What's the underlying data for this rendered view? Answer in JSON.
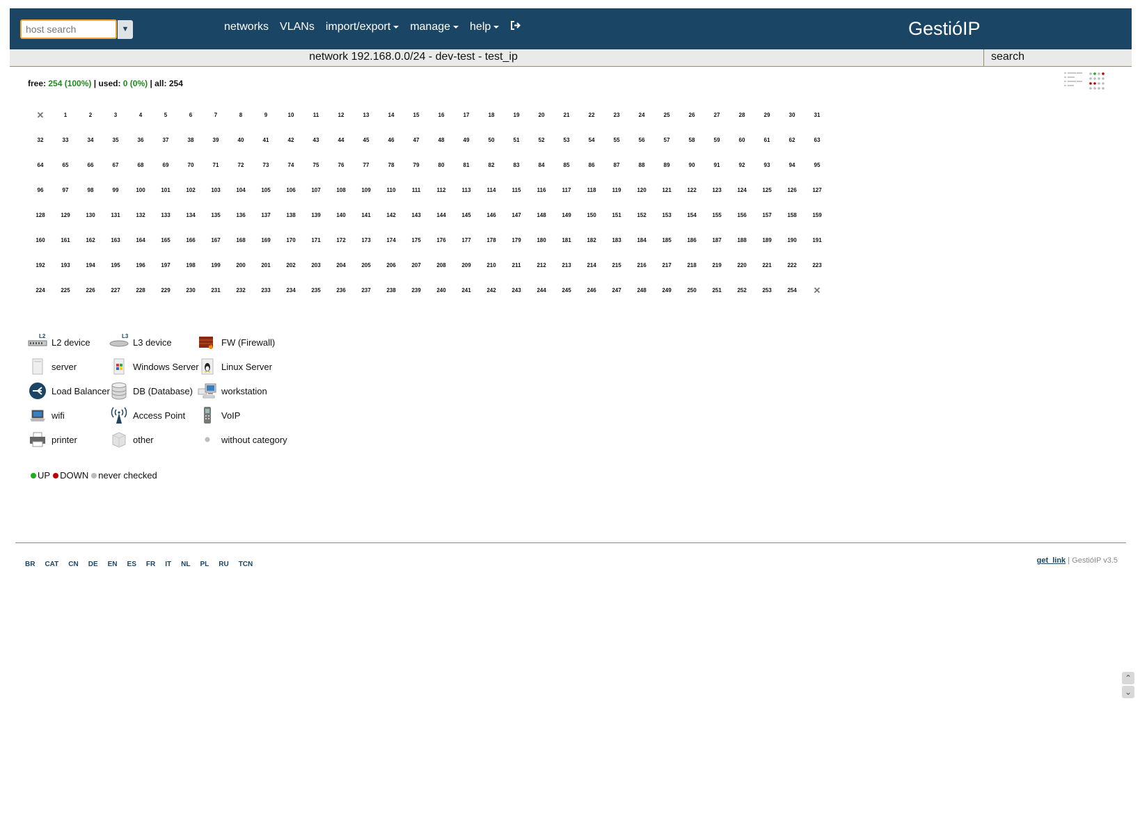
{
  "header": {
    "search_placeholder": "host search",
    "nav": [
      {
        "label": "networks",
        "dropdown": false
      },
      {
        "label": "VLANs",
        "dropdown": false
      },
      {
        "label": "import/export",
        "dropdown": true
      },
      {
        "label": "manage",
        "dropdown": true
      },
      {
        "label": "help",
        "dropdown": true
      }
    ],
    "brand": "GestióIP"
  },
  "titlebar": {
    "title": "network 192.168.0.0/24 - dev-test - test_ip",
    "search_label": "search"
  },
  "stats": {
    "free_label": "free:",
    "free_value": "254 (100%)",
    "used_label": "used:",
    "used_value": "0 (0%)",
    "all_label": "all:",
    "all_value": "254"
  },
  "ip_grid": {
    "first": 1,
    "last": 254,
    "columns": 32,
    "marker": "✕"
  },
  "legend": [
    {
      "label": "L2 device",
      "icon": "l2-device-icon"
    },
    {
      "label": "L3 device",
      "icon": "l3-device-icon"
    },
    {
      "label": "FW (Firewall)",
      "icon": "firewall-icon"
    },
    {
      "label": "server",
      "icon": "server-icon"
    },
    {
      "label": "Windows Server",
      "icon": "windows-server-icon"
    },
    {
      "label": "Linux Server",
      "icon": "linux-server-icon"
    },
    {
      "label": "Load Balancer",
      "icon": "load-balancer-icon"
    },
    {
      "label": "DB (Database)",
      "icon": "database-icon"
    },
    {
      "label": "workstation",
      "icon": "workstation-icon"
    },
    {
      "label": "wifi",
      "icon": "wifi-icon"
    },
    {
      "label": "Access Point",
      "icon": "access-point-icon"
    },
    {
      "label": "VoIP",
      "icon": "voip-icon"
    },
    {
      "label": "printer",
      "icon": "printer-icon"
    },
    {
      "label": "other",
      "icon": "other-icon"
    },
    {
      "label": "without category",
      "icon": "without-category-icon"
    }
  ],
  "status_legend": {
    "up": "UP",
    "down": "DOWN",
    "never": "never checked",
    "colors": {
      "up": "#1fae1f",
      "down": "#c00000",
      "never": "#bbbbbb"
    }
  },
  "footer": {
    "languages": [
      "BR",
      "CAT",
      "CN",
      "DE",
      "EN",
      "ES",
      "FR",
      "IT",
      "NL",
      "PL",
      "RU",
      "TCN"
    ],
    "link": "get_link",
    "version": "| GestióIP v3.5"
  },
  "colors": {
    "header_bg": "#1a4565",
    "accent": "#f0a830",
    "free_green": "#1e8a1e"
  }
}
